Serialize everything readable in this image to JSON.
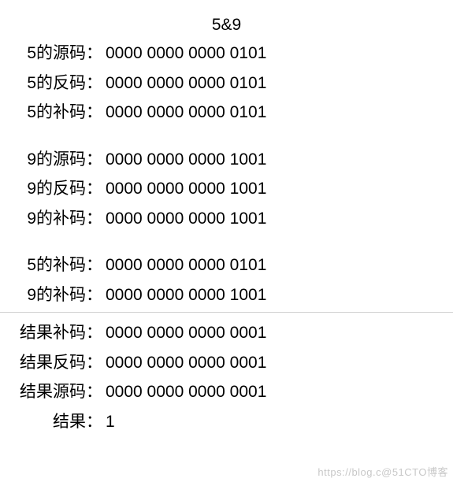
{
  "title": "5&9",
  "group1": [
    {
      "label": "5的源码：",
      "value": "0000 0000 0000 0101"
    },
    {
      "label": "5的反码：",
      "value": "0000 0000 0000 0101"
    },
    {
      "label": "5的补码：",
      "value": "0000 0000 0000 0101"
    }
  ],
  "group2": [
    {
      "label": "9的源码：",
      "value": "0000 0000 0000 1001"
    },
    {
      "label": "9的反码：",
      "value": "0000 0000 0000 1001"
    },
    {
      "label": "9的补码：",
      "value": "0000 0000 0000 1001"
    }
  ],
  "group3": [
    {
      "label": "5的补码：",
      "value": "0000 0000 0000 0101"
    },
    {
      "label": "9的补码：",
      "value": "0000 0000 0000 1001"
    }
  ],
  "results": [
    {
      "label": "结果补码：",
      "value": "0000 0000 0000 0001"
    },
    {
      "label": "结果反码：",
      "value": "0000 0000 0000 0001"
    },
    {
      "label": "结果源码：",
      "value": "0000 0000 0000 0001"
    },
    {
      "label": "结果：",
      "value": "1"
    }
  ],
  "watermark": "https://blog.c@51CTO博客"
}
